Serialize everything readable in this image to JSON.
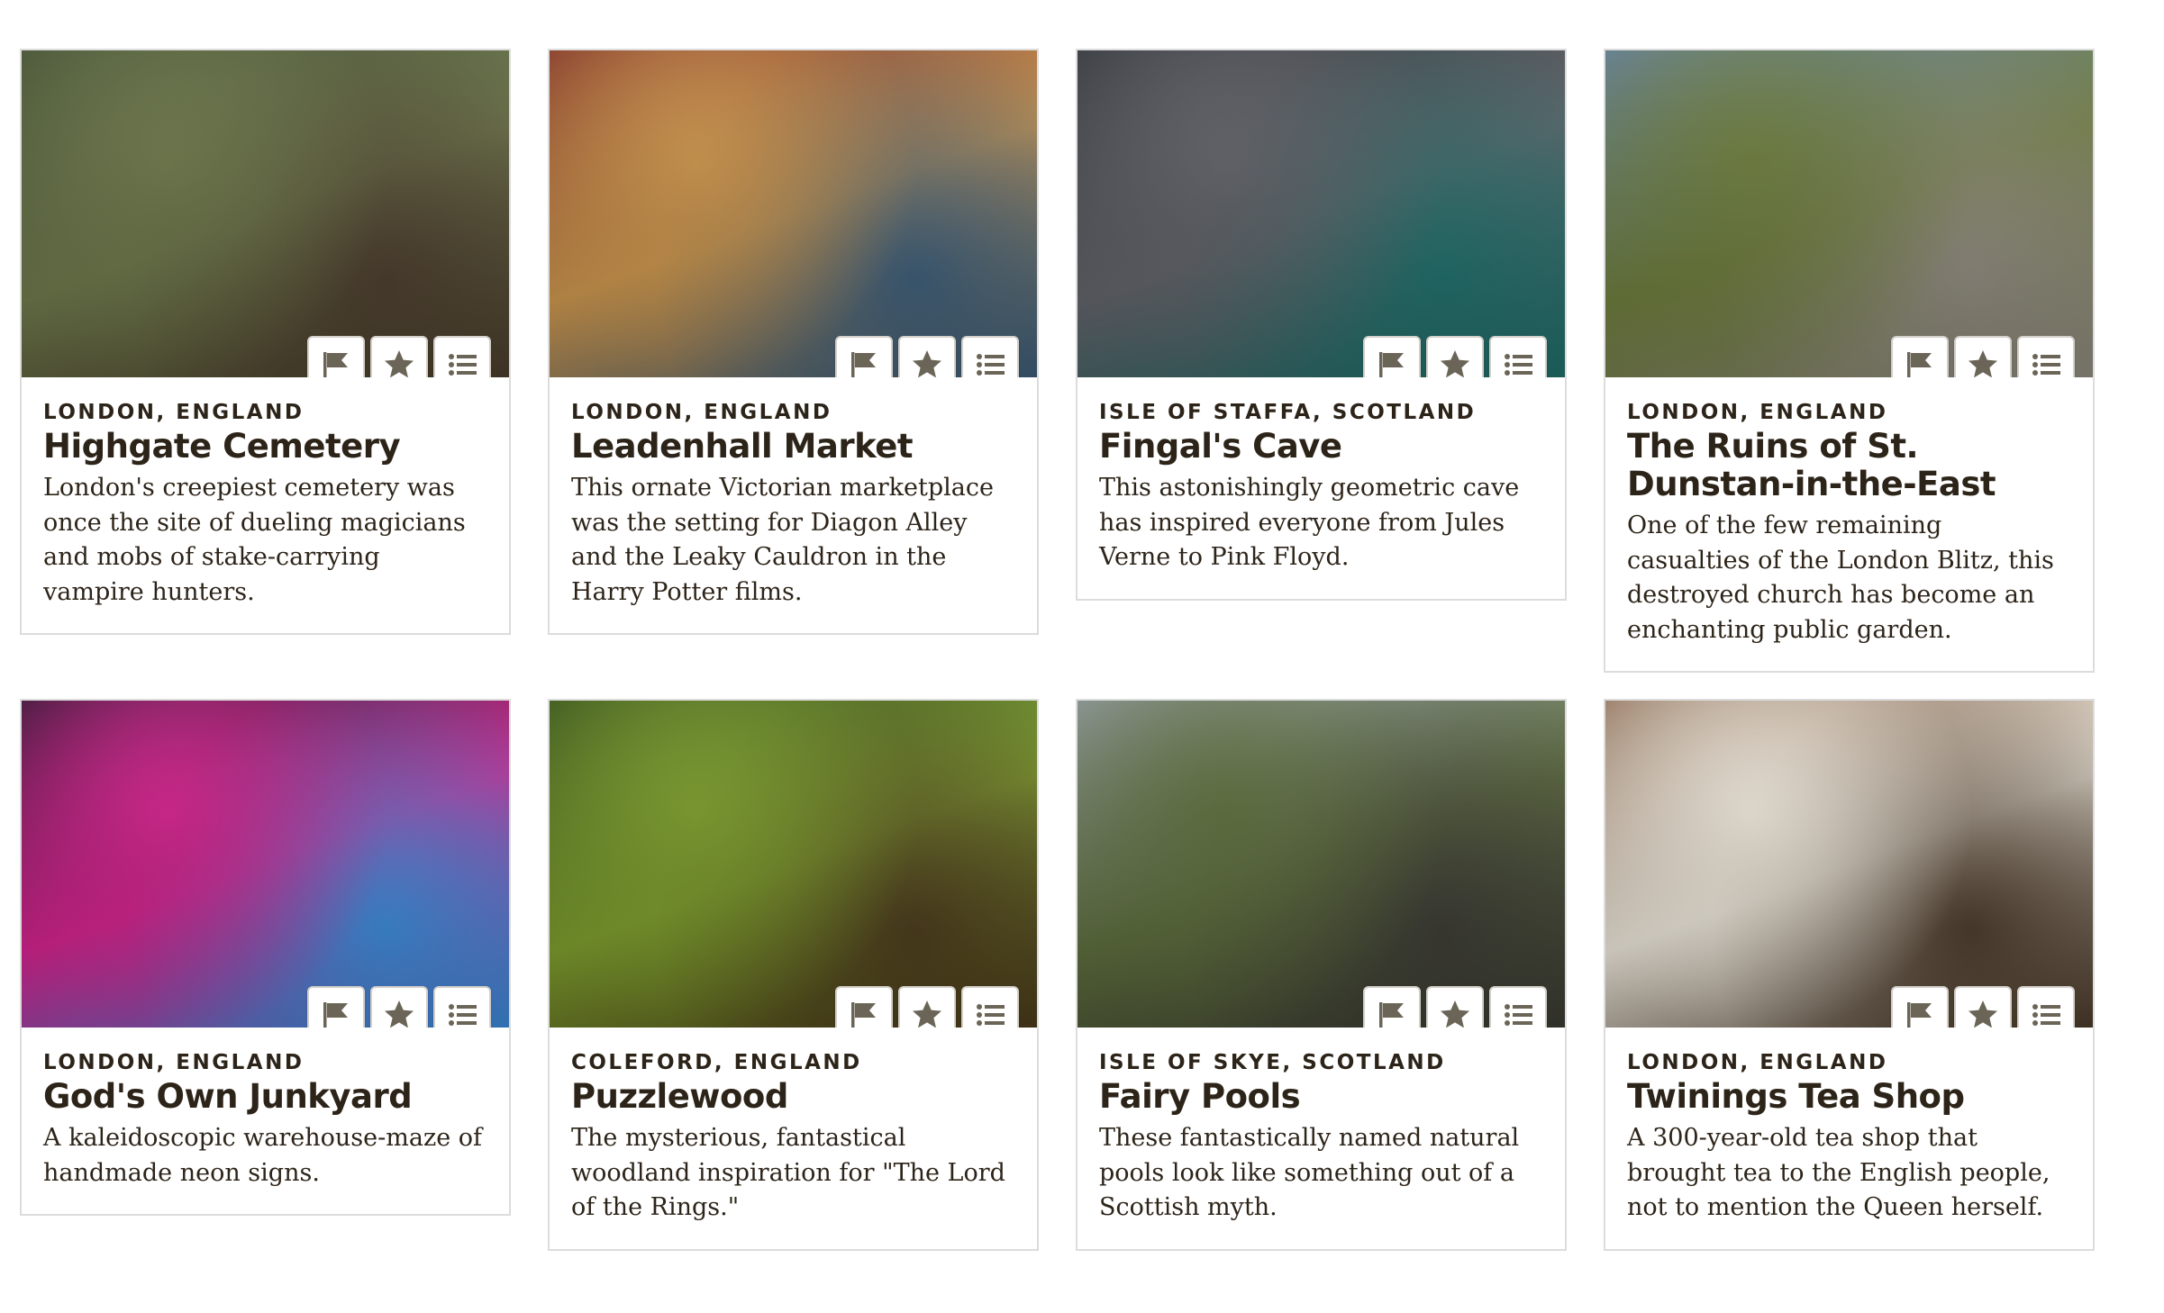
{
  "cards": [
    {
      "location": "LONDON, ENGLAND",
      "title": "Highgate Cemetery",
      "description": "London's creepiest cemetery was once the site of dueling magicians and mobs of stake-carrying vampire hunters.",
      "image": "forest-cemetery-photo",
      "colors": [
        "#3c4a2c",
        "#6b7548",
        "#4a3c2c"
      ]
    },
    {
      "location": "LONDON, ENGLAND",
      "title": "Leadenhall Market",
      "description": "This ornate Victorian marketplace was the setting for Diagon Alley and the Leaky Cauldron in the Harry Potter films.",
      "image": "victorian-arcade-photo",
      "colors": [
        "#7a2a1e",
        "#c9934a",
        "#3b5c78"
      ]
    },
    {
      "location": "ISLE OF STAFFA, SCOTLAND",
      "title": "Fingal's Cave",
      "description": "This astonishingly geometric cave has inspired everyone from Jules Verne to Pink Floyd.",
      "image": "basalt-cave-photo",
      "colors": [
        "#2b2e33",
        "#5e6066",
        "#1e6e6a"
      ]
    },
    {
      "location": "LONDON, ENGLAND",
      "title": "The Ruins of St. Dunstan-in-the-East",
      "description": "One of the few remaining casualties of the London Blitz, this destroyed church has become an enchanting public garden.",
      "image": "church-ruins-photo",
      "colors": [
        "#5c7a9a",
        "#6b7a3a",
        "#8f8a7e"
      ]
    },
    {
      "location": "LONDON, ENGLAND",
      "title": "God's Own Junkyard",
      "description": "A kaleidoscopic warehouse-maze of handmade neon signs.",
      "image": "neon-signs-photo",
      "colors": [
        "#2a0d2a",
        "#d0208a",
        "#3a8ad8"
      ]
    },
    {
      "location": "COLEFORD, ENGLAND",
      "title": "Puzzlewood",
      "description": "The mysterious, fantastical woodland inspiration for \"The Lord of the Rings.\"",
      "image": "mossy-woodland-photo",
      "colors": [
        "#2e4a12",
        "#7a9a2a",
        "#4a3a1a"
      ]
    },
    {
      "location": "ISLE OF SKYE, SCOTLAND",
      "title": "Fairy Pools",
      "description": "These fantastically named natural pools look like something out of a Scottish myth.",
      "image": "waterfall-valley-photo",
      "colors": [
        "#8a949a",
        "#5a6a3a",
        "#3a3a32"
      ]
    },
    {
      "location": "LONDON, ENGLAND",
      "title": "Twinings Tea Shop",
      "description": "A 300-year-old tea shop that brought tea to the English people, not to mention the Queen herself.",
      "image": "tea-shop-storefront-photo",
      "colors": [
        "#8a6a52",
        "#e8e2d6",
        "#4a3a2a"
      ]
    }
  ],
  "icon_color": "#6b6558"
}
